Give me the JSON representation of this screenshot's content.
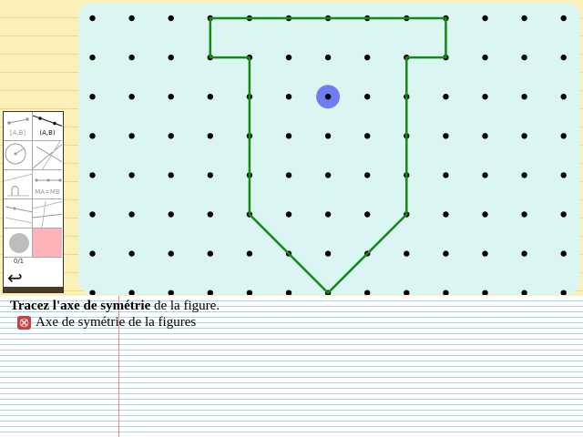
{
  "toolbox": {
    "tools": [
      {
        "name": "segment-tool",
        "label": "[A,B]"
      },
      {
        "name": "line-tool",
        "label": "(A,B)"
      },
      {
        "name": "circle-tool",
        "label": ""
      },
      {
        "name": "perpendicular-tool",
        "label": ""
      },
      {
        "name": "compass-tool",
        "label": ""
      },
      {
        "name": "midpoint-tool",
        "label": "MA=MB"
      },
      {
        "name": "angle-tool",
        "label": ""
      },
      {
        "name": "parallel-tool",
        "label": ""
      },
      {
        "name": "point-tool",
        "label": ""
      },
      {
        "name": "eraser-tool",
        "label": ""
      }
    ],
    "counter": "0/1",
    "undo_icon": "undo-arrow-icon"
  },
  "board": {
    "background": "#dbf6f2",
    "grid": {
      "columns": 13,
      "rows": 8
    },
    "figure": {
      "color": "#138a13",
      "vertices": [
        [
          3,
          0
        ],
        [
          9,
          0
        ],
        [
          9,
          1
        ],
        [
          8,
          1
        ],
        [
          8,
          5
        ],
        [
          6,
          7
        ],
        [
          4,
          5
        ],
        [
          4,
          1
        ],
        [
          3,
          1
        ]
      ]
    },
    "cursor": {
      "col": 6,
      "row": 2,
      "color": "#6f7df0"
    }
  },
  "exercise": {
    "instruction_bold": "Tracez l'axe de symétrie",
    "instruction_rest": " de la figure.",
    "objective": "Axe de symétrie de la figures",
    "status_color": "#c94040",
    "status_icon": "fail-cross-icon"
  }
}
